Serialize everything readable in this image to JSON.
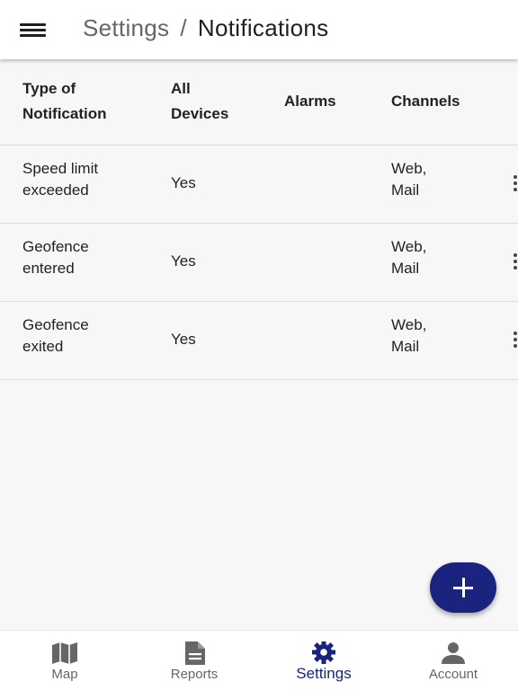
{
  "header": {
    "menu_icon": "hamburger-menu-icon",
    "breadcrumb_parent": "Settings",
    "separator": "/",
    "title": "Notifications"
  },
  "table": {
    "columns": [
      {
        "line1": "Type of",
        "line2": "Notification"
      },
      {
        "line1": "All",
        "line2": "Devices"
      },
      {
        "line1": "Alarms"
      },
      {
        "line1": "Channels"
      }
    ],
    "rows": [
      {
        "type_line1": "Speed limit",
        "type_line2": "exceeded",
        "all_devices": "Yes",
        "alarms": "",
        "channels_line1": "Web,",
        "channels_line2": "Mail"
      },
      {
        "type_line1": "Geofence",
        "type_line2": "entered",
        "all_devices": "Yes",
        "alarms": "",
        "channels_line1": "Web,",
        "channels_line2": "Mail"
      },
      {
        "type_line1": "Geofence",
        "type_line2": "exited",
        "all_devices": "Yes",
        "alarms": "",
        "channels_line1": "Web,",
        "channels_line2": "Mail"
      }
    ]
  },
  "fab": {
    "icon": "plus-icon"
  },
  "bottom_nav": {
    "items": [
      {
        "label": "Map",
        "icon": "map-icon",
        "active": false
      },
      {
        "label": "Reports",
        "icon": "document-icon",
        "active": false
      },
      {
        "label": "Settings",
        "icon": "gear-icon",
        "active": true
      },
      {
        "label": "Account",
        "icon": "person-icon",
        "active": false
      }
    ]
  },
  "colors": {
    "primary": "#1a237e",
    "inactive": "#666666",
    "background": "#f8f7f8",
    "divider": "#dddddd"
  }
}
